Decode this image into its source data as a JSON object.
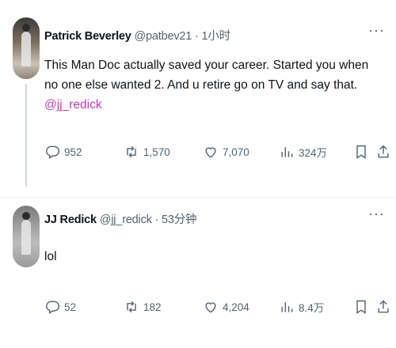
{
  "tweets": [
    {
      "author_name": "Patrick Beverley",
      "handle": "@patbev21",
      "separator": "·",
      "time": "1小时",
      "more": "···",
      "text_before": "This Man Doc actually saved your career. Started you when no one else wanted 2. And u retire go on TV and say that. ",
      "mention": "@jj_redick",
      "stats": {
        "replies": "952",
        "retweets": "1,570",
        "likes": "7,070",
        "views": "324万"
      }
    },
    {
      "author_name": "JJ Redick",
      "handle": "@jj_redick",
      "separator": "·",
      "time": "53分钟",
      "more": "···",
      "text_before": "lol",
      "mention": "",
      "stats": {
        "replies": "52",
        "retweets": "182",
        "likes": "4,204",
        "views": "8.4万"
      }
    }
  ],
  "colors": {
    "mention": "#c03bb5",
    "muted": "#536471",
    "text": "#0f1419"
  },
  "icons": [
    "reply-icon",
    "retweet-icon",
    "like-icon",
    "views-icon",
    "bookmark-icon",
    "share-icon",
    "more-icon"
  ]
}
